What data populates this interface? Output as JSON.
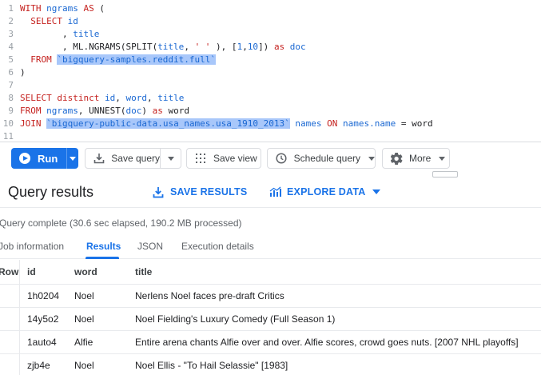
{
  "editor": {
    "lines": [
      {
        "n": "1",
        "parts": [
          {
            "t": "WITH ",
            "c": "kw"
          },
          {
            "t": "ngrams ",
            "c": "tok"
          },
          {
            "t": "AS",
            "c": "kw"
          },
          {
            "t": " (",
            "c": "txt"
          }
        ]
      },
      {
        "n": "2",
        "parts": [
          {
            "t": "  SELECT ",
            "c": "kw"
          },
          {
            "t": "id",
            "c": "tok"
          }
        ]
      },
      {
        "n": "3",
        "parts": [
          {
            "t": "        , ",
            "c": "txt"
          },
          {
            "t": "title",
            "c": "tok"
          }
        ]
      },
      {
        "n": "4",
        "parts": [
          {
            "t": "        , ML.NGRAMS(SPLIT(",
            "c": "txt"
          },
          {
            "t": "title",
            "c": "tok"
          },
          {
            "t": ", ",
            "c": "txt"
          },
          {
            "t": "' '",
            "c": "kw"
          },
          {
            "t": " ), [",
            "c": "txt"
          },
          {
            "t": "1",
            "c": "tok"
          },
          {
            "t": ",",
            "c": "txt"
          },
          {
            "t": "10",
            "c": "tok"
          },
          {
            "t": "]) ",
            "c": "txt"
          },
          {
            "t": "as",
            "c": "kw"
          },
          {
            "t": " doc",
            "c": "tok"
          }
        ]
      },
      {
        "n": "5",
        "parts": [
          {
            "t": "  FROM ",
            "c": "kw"
          },
          {
            "t": "`bigquery-samples.reddit.full`",
            "c": "hl"
          }
        ]
      },
      {
        "n": "6",
        "parts": [
          {
            "t": ")",
            "c": "txt"
          }
        ]
      },
      {
        "n": "7",
        "parts": []
      },
      {
        "n": "8",
        "parts": [
          {
            "t": "SELECT distinct ",
            "c": "kw"
          },
          {
            "t": "id",
            "c": "tok"
          },
          {
            "t": ", ",
            "c": "txt"
          },
          {
            "t": "word",
            "c": "tok"
          },
          {
            "t": ", ",
            "c": "txt"
          },
          {
            "t": "title",
            "c": "tok"
          }
        ]
      },
      {
        "n": "9",
        "parts": [
          {
            "t": "FROM ",
            "c": "kw"
          },
          {
            "t": "ngrams",
            "c": "tok"
          },
          {
            "t": ", UNNEST(",
            "c": "txt"
          },
          {
            "t": "doc",
            "c": "tok"
          },
          {
            "t": ") ",
            "c": "txt"
          },
          {
            "t": "as",
            "c": "kw"
          },
          {
            "t": " word",
            "c": "txt"
          }
        ]
      },
      {
        "n": "10",
        "parts": [
          {
            "t": "JOIN ",
            "c": "kw"
          },
          {
            "t": "`bigquery-public-data.usa_names.usa_1910_2013`",
            "c": "hl"
          },
          {
            "t": " names ",
            "c": "tok"
          },
          {
            "t": "ON",
            "c": "kw"
          },
          {
            "t": " names.name ",
            "c": "tok"
          },
          {
            "t": "= word",
            "c": "txt"
          }
        ]
      },
      {
        "n": "11",
        "parts": []
      }
    ]
  },
  "toolbar": {
    "run_label": "Run",
    "save_query_label": "Save query",
    "save_view_label": "Save view",
    "schedule_query_label": "Schedule query",
    "more_label": "More"
  },
  "results": {
    "title": "Query results",
    "save_results_label": "SAVE RESULTS",
    "explore_data_label": "EXPLORE DATA",
    "status": "Query complete (30.6 sec elapsed, 190.2 MB processed)",
    "tabs": [
      "Job information",
      "Results",
      "JSON",
      "Execution details"
    ],
    "active_tab": "Results"
  },
  "table": {
    "columns": [
      "Row",
      "id",
      "word",
      "title"
    ],
    "rows": [
      {
        "id": "1h0204",
        "word": "Noel",
        "title": "Nerlens Noel faces pre-draft Critics"
      },
      {
        "id": "14y5o2",
        "word": "Noel",
        "title": "Noel Fielding's Luxury Comedy (Full Season 1)"
      },
      {
        "id": "1auto4",
        "word": "Alfie",
        "title": "Entire arena chants Alfie over and over. Alfie scores, crowd goes nuts. [2007 NHL playoffs]"
      },
      {
        "id": "zjb4e",
        "word": "Noel",
        "title": "Noel Ellis - \"To Hail Selassie\" [1983]"
      }
    ]
  },
  "colors": {
    "accent": "#1a73e8",
    "keyword": "#c5221f",
    "identifier": "#1967d2",
    "highlight": "#a8c7fa"
  },
  "icons": {
    "run": "play-circle-icon",
    "save_query": "save-download-icon",
    "save_view": "view-grid-icon",
    "schedule": "clock-icon",
    "more": "gear-icon",
    "save_results": "download-icon",
    "explore_data": "bar-chart-icon"
  }
}
